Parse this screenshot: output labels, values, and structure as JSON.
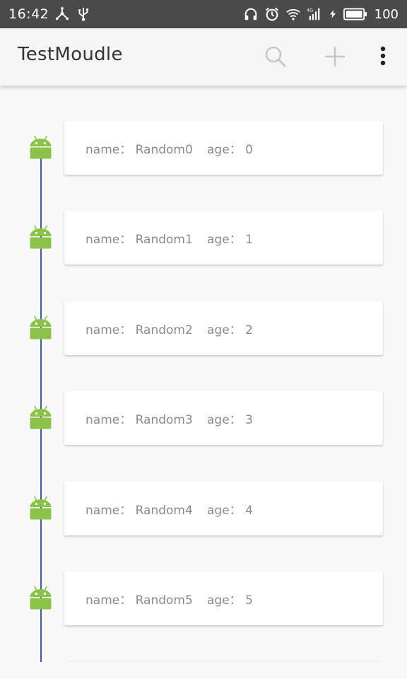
{
  "status_bar": {
    "time": "16:42",
    "battery_level": "100",
    "left_icons": [
      "share-icon",
      "usb-icon"
    ],
    "right_icons": [
      "headphones-icon",
      "alarm-icon",
      "wifi-icon",
      "signal-4g-icon",
      "charging-icon",
      "battery-icon"
    ]
  },
  "app_bar": {
    "title": "TestMoudle",
    "actions": [
      "search-icon",
      "add-icon",
      "more-vert-icon"
    ]
  },
  "items": [
    {
      "name": "name： Random0",
      "age": "age： 0"
    },
    {
      "name": "name： Random1",
      "age": "age： 1"
    },
    {
      "name": "name： Random2",
      "age": "age： 2"
    },
    {
      "name": "name： Random3",
      "age": "age： 3"
    },
    {
      "name": "name： Random4",
      "age": "age： 4"
    },
    {
      "name": "name： Random5",
      "age": "age： 5"
    }
  ],
  "colors": {
    "status_bar": "#4a4a4a",
    "app_bar": "#f5f5f5",
    "timeline_line": "#3f5e94",
    "android_green": "#8bc34a",
    "item_text": "#8a8a8a"
  }
}
